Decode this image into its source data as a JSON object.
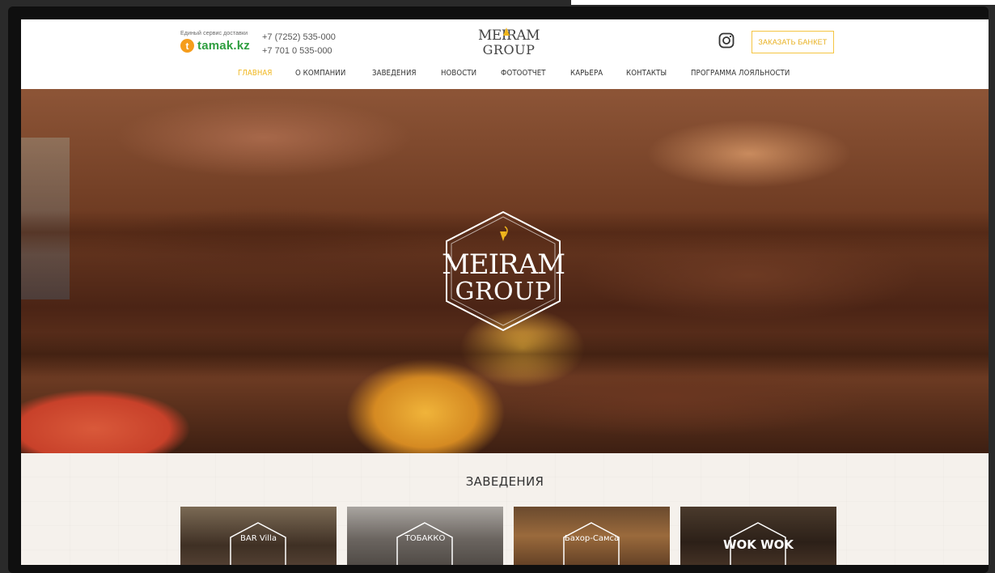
{
  "header": {
    "delivery_caption": "Единый сервис доставки",
    "delivery_brand": "tamak.kz",
    "delivery_brand_initial": "t",
    "phone_1": "+7 (7252) 535-000",
    "phone_2": "+7 701 0 535-000",
    "logo_line1": "MEIRAM",
    "logo_line2": "GROUP",
    "order_button": "ЗАКАЗАТЬ БАНКЕТ",
    "instagram_icon": "instagram-icon"
  },
  "nav": {
    "items": [
      {
        "label": "ГЛАВНАЯ",
        "active": true
      },
      {
        "label": "О КОМПАНИИ",
        "active": false
      },
      {
        "label": "ЗАВЕДЕНИЯ",
        "active": false
      },
      {
        "label": "НОВОСТИ",
        "active": false
      },
      {
        "label": "ФОТООТЧЕТ",
        "active": false
      },
      {
        "label": "КАРЬЕРА",
        "active": false
      },
      {
        "label": "КОНТАКТЫ",
        "active": false
      },
      {
        "label": "ПРОГРАММА ЛОЯЛЬНОСТИ",
        "active": false
      }
    ]
  },
  "hero": {
    "logo_line1": "MEIRAM",
    "logo_line2": "GROUP"
  },
  "section": {
    "title": "ЗАВЕДЕНИЯ",
    "cards": [
      {
        "label": "BAR Villa"
      },
      {
        "label": "ТОБАККО"
      },
      {
        "label": "Бахор-Самса"
      },
      {
        "label": "WOK WOK"
      }
    ]
  },
  "colors": {
    "accent": "#f0b61c",
    "tamak_green": "#2e9e3f",
    "tamak_orange": "#f59d1c"
  }
}
